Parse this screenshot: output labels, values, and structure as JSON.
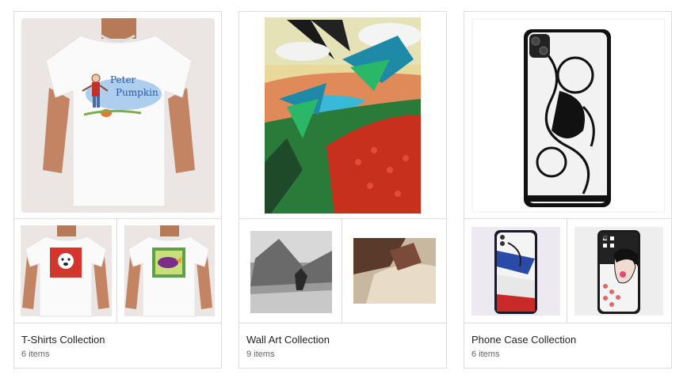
{
  "collections": [
    {
      "title": "T-Shirts Collection",
      "count": "6 items",
      "main_image": "kids-tshirt-peter-pumpkin",
      "main_text_line1": "Peter",
      "main_text_line2": "Pumpkin",
      "thumbs": [
        "kids-tshirt-dog",
        "kids-tshirt-bird"
      ]
    },
    {
      "title": "Wall Art Collection",
      "count": "9 items",
      "main_image": "birds-landscape-painting",
      "thumbs": [
        "monochrome-landscape-print",
        "abstract-bird-print"
      ]
    },
    {
      "title": "Phone Case Collection",
      "count": "6 items",
      "main_image": "celtic-bird-phone-case",
      "thumbs": [
        "abstract-face-phone-case",
        "pop-art-woman-phone-case"
      ]
    }
  ],
  "colors": {
    "border": "#dcdcdc",
    "title": "#222222",
    "count": "#666666"
  }
}
